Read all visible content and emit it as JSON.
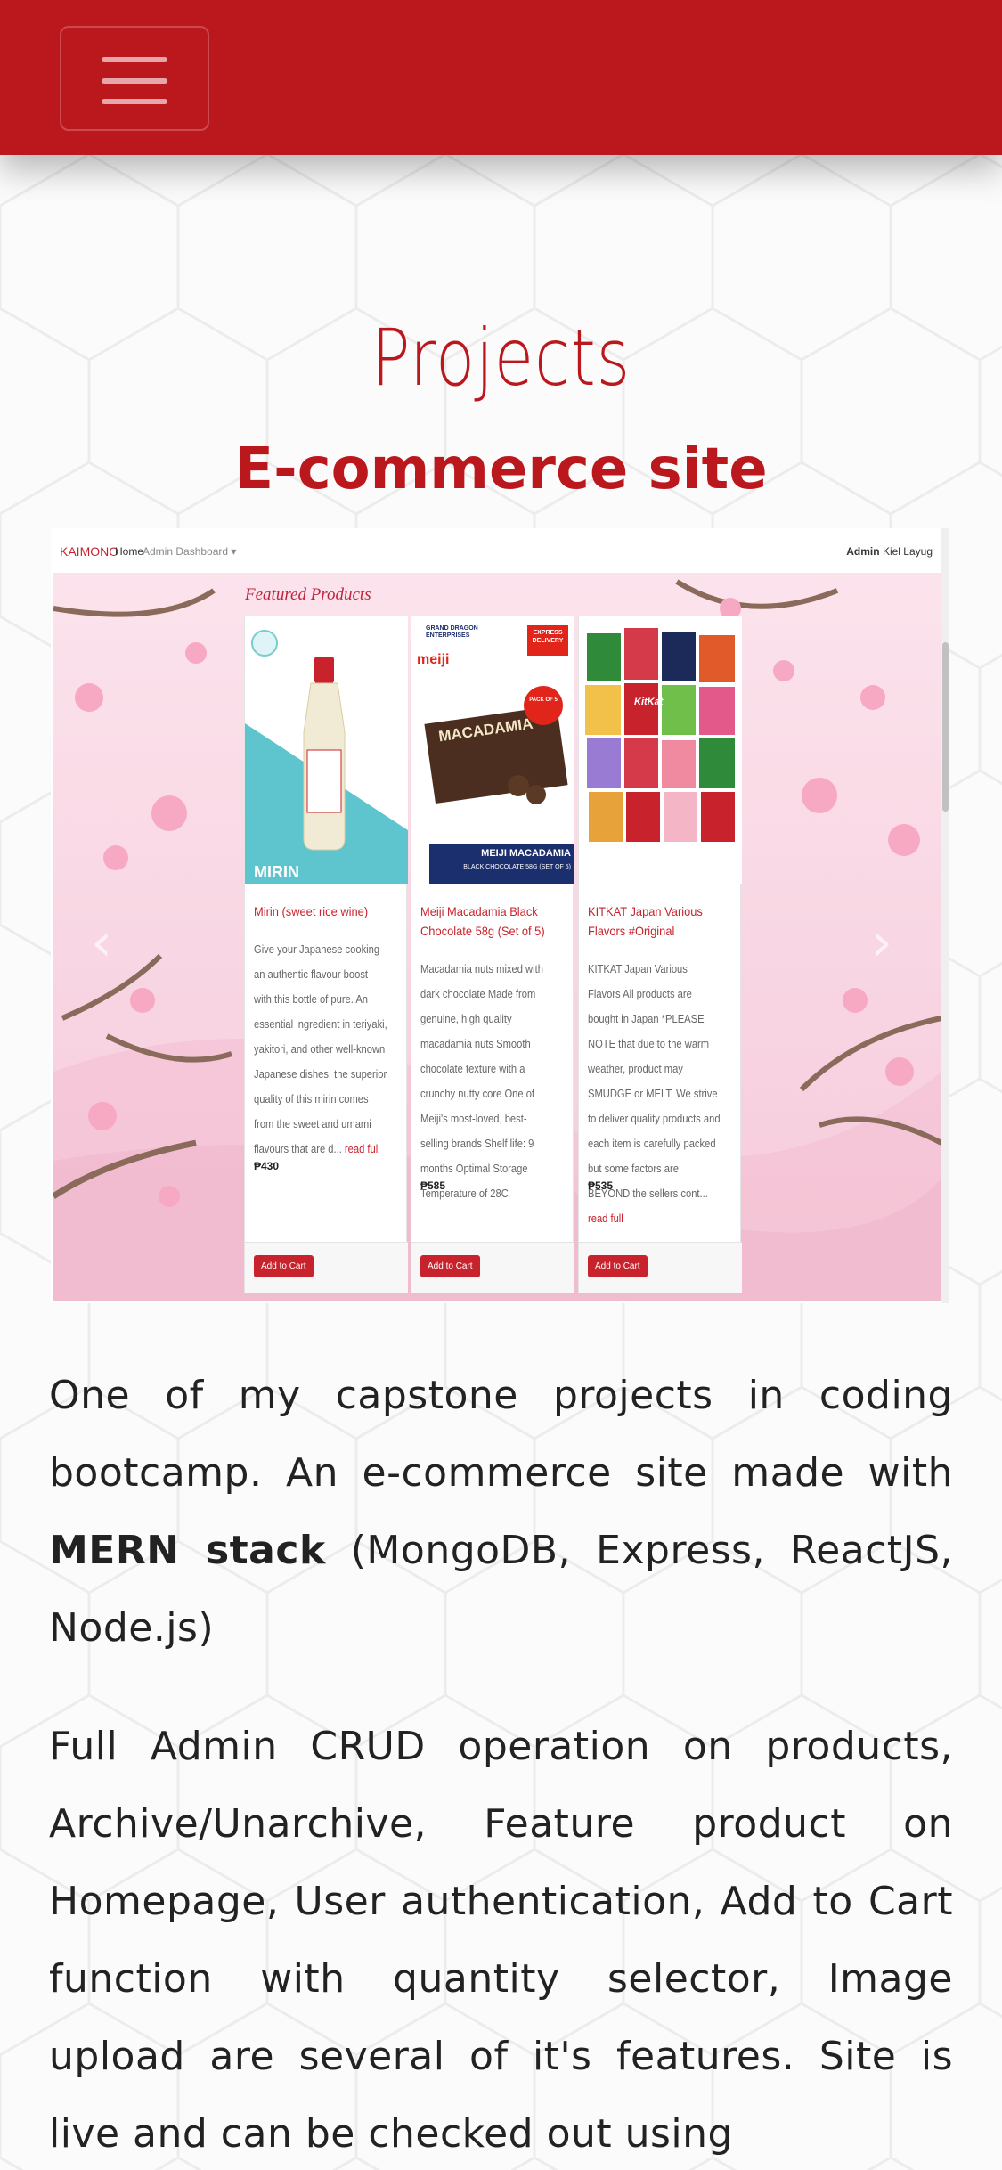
{
  "header": {
    "menu_icon": "hamburger-menu-icon"
  },
  "section": {
    "title": "Projects",
    "project_title": "E-commerce site"
  },
  "screenshot": {
    "brand": "KAIMONO",
    "nav_home": "Home",
    "nav_admin": "Admin Dashboard ▾",
    "user_role": "Admin",
    "user_name": "Kiel Layug",
    "featured_heading": "Featured Products",
    "cards": [
      {
        "name": "Mirin (sweet rice wine)",
        "image_label": "MIRIN",
        "description": "Give your Japanese cooking an authentic flavour boost with this bottle of pure. An essential ingredient in teriyaki, yakitori, and other well-known Japanese dishes, the superior quality of this mirin comes from the sweet and umami flavours that are d...",
        "read_full": "read full",
        "price": "₱430",
        "button": "Add to Cart"
      },
      {
        "name": "Meiji Macadamia Black Chocolate 58g (Set of 5)",
        "image_brand": "GRAND DRAGON ENTERPRISES",
        "image_badge": "EXPRESS DELIVERY",
        "image_logo": "meiji",
        "image_pack": "PACK OF 5",
        "image_box": "MACADAMIA",
        "image_caption_1": "MEIJI MACADAMIA",
        "image_caption_2": "BLACK CHOCOLATE 58G (SET OF 5)",
        "description": "Macadamia nuts mixed with dark chocolate Made from genuine, high quality macadamia nuts Smooth chocolate texture with a crunchy nutty core One of Meiji's most-loved, best-selling brands Shelf life: 9 months Optimal Storage Temperature of 28C",
        "read_full": "",
        "price": "₱585",
        "button": "Add to Cart"
      },
      {
        "name": "KITKAT Japan Various Flavors #Original",
        "image_logo": "KitKat",
        "description": "KITKAT Japan Various Flavors All products are bought in Japan *PLEASE NOTE that due to the warm weather, product may SMUDGE or MELT. We strive to deliver quality products and each item is carefully packed but some factors are BEYOND the sellers cont...",
        "read_full": "read full",
        "price": "₱535",
        "button": "Add to Cart"
      }
    ]
  },
  "paragraphs": {
    "p1_before": "One of my capstone projects in coding bootcamp. An e-commerce site made with ",
    "p1_bold": "MERN stack",
    "p1_after": " (MongoDB, Express, ReactJS, Node.js)",
    "p2": "Full Admin CRUD operation on products, Archive/Unarchive, Feature product on Homepage, User authentication, Add to Cart function with quantity selector, Image upload are several of it's features. Site is live and can be checked out using"
  },
  "colors": {
    "brand_red": "#bb181e",
    "text": "#222222",
    "background": "#fbfbfb"
  }
}
